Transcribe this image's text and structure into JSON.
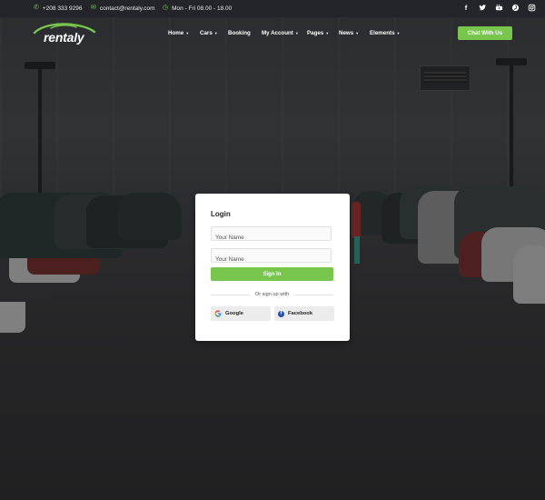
{
  "topbar": {
    "phone": "+208 333 9296",
    "email": "contact@rentaly.com",
    "hours": "Mon - Fri 08.00 - 18.00",
    "phone_icon": "phone-icon",
    "email_icon": "mail-icon",
    "hours_icon": "clock-icon",
    "socials": [
      "facebook-icon",
      "twitter-icon",
      "youtube-icon",
      "pinterest-icon",
      "instagram-icon"
    ]
  },
  "header": {
    "logo_text": "rentaly",
    "nav": [
      {
        "label": "Home",
        "dropdown": true
      },
      {
        "label": "Cars",
        "dropdown": true
      },
      {
        "label": "Booking",
        "dropdown": false
      },
      {
        "label": "My Account",
        "dropdown": true
      },
      {
        "label": "Pages",
        "dropdown": true
      },
      {
        "label": "News",
        "dropdown": true
      },
      {
        "label": "Elements",
        "dropdown": true
      }
    ],
    "cta_label": "Chat With Us"
  },
  "login": {
    "title": "Login",
    "name_placeholder": "Your Name",
    "password_placeholder": "Your Name",
    "submit_label": "Sign In",
    "divider_text": "Or sign up with",
    "google_label": "Google",
    "facebook_label": "Facebook"
  },
  "colors": {
    "accent": "#78c64e",
    "topbar_bg": "#23252a",
    "facebook_blue": "#2a4ea3"
  }
}
